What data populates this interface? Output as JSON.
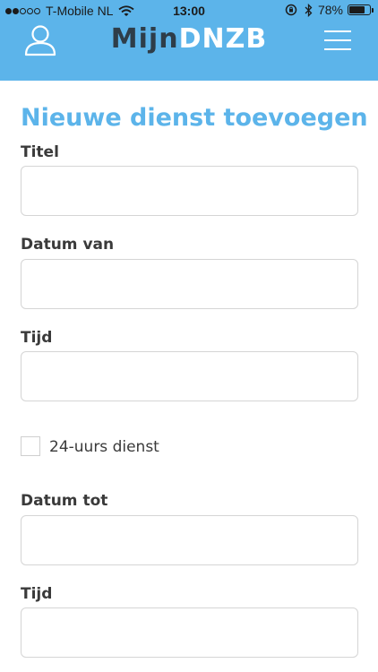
{
  "status_bar": {
    "carrier": "T-Mobile NL",
    "time": "13:00",
    "battery": "78%",
    "battery_level": 0.78
  },
  "header": {
    "brand_part1": "Mijn",
    "brand_part2": "DNZB",
    "accent_color": "#5cb4ea"
  },
  "form": {
    "title": "Nieuwe dienst toevoegen",
    "fields": [
      {
        "label": "Titel",
        "value": ""
      },
      {
        "label": "Datum van",
        "value": ""
      },
      {
        "label": "Tijd",
        "value": ""
      },
      {
        "label": "Datum tot",
        "value": ""
      },
      {
        "label": "Tijd",
        "value": ""
      }
    ],
    "checkbox": {
      "label": "24-uurs dienst",
      "checked": false
    }
  }
}
